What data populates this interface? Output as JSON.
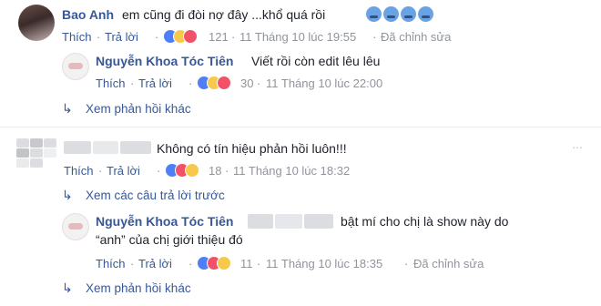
{
  "comments": [
    {
      "author": "Bao Anh",
      "text": "em cũng đi đòi nợ đây ...khổ quá rồi",
      "actions": {
        "like": "Thích",
        "reply": "Trả lời"
      },
      "reaction_count": "121",
      "time": "11 Tháng 10 lúc 19:55",
      "edited": "Đã chỉnh sửa",
      "replies": [
        {
          "author": "Nguyễn Khoa Tóc Tiên",
          "text": "Viết rồi còn edit lêu lêu",
          "actions": {
            "like": "Thích",
            "reply": "Trả lời"
          },
          "reaction_count": "30",
          "time": "11 Tháng 10 lúc 22:00"
        }
      ],
      "more_replies": "Xem phản hồi khác"
    },
    {
      "author": "",
      "text": "Không có tín hiệu phản hồi luôn!!!",
      "actions": {
        "like": "Thích",
        "reply": "Trả lời"
      },
      "reaction_count": "18",
      "time": "11 Tháng 10 lúc 18:32",
      "previous_replies": "Xem các câu trả lời trước",
      "replies": [
        {
          "author": "Nguyễn Khoa Tóc Tiên",
          "text_line1": "bật mí cho chị là show này do",
          "text_line2": "“anh” của chị giới thiệu đó",
          "actions": {
            "like": "Thích",
            "reply": "Trả lời"
          },
          "reaction_count": "11",
          "time": "11 Tháng 10 lúc 18:35",
          "edited": "Đã chỉnh sửa"
        }
      ],
      "more_replies": "Xem phản hồi khác"
    }
  ],
  "icons": [
    "reply-arrow-icon",
    "more-options-icon",
    "like-reaction-icon",
    "haha-reaction-icon",
    "love-reaction-icon",
    "sad-emoji-icon"
  ],
  "colors": {
    "link": "#365899",
    "meta": "#90949c",
    "like": "#4f7ff7",
    "love": "#f25268",
    "haha": "#f7c94a"
  }
}
